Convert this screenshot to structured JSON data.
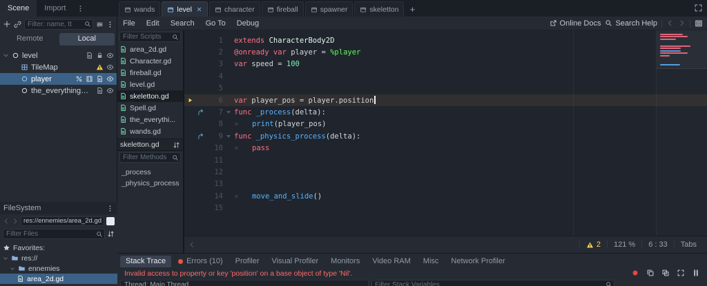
{
  "colors": {
    "accent": "#5d9de2",
    "selection": "#3c6186",
    "error": "#ff6b6b",
    "warning": "#ffd24d",
    "kw": "#ff7085",
    "fn": "#57b3ff",
    "type": "#e4f7ee",
    "id": "#d4d7dc",
    "uniq": "#63f95c",
    "num": "#7ef2b3",
    "script_icon": "#74dcb2",
    "exec_arrow": "#ffd24d",
    "override_arrow": "#62b2e2",
    "record": "#e8463c",
    "error_dot": "#f05540"
  },
  "top_bar": {
    "dock_tabs": [
      "Scene",
      "Import"
    ],
    "scene_tabs": [
      {
        "label": "wands",
        "active": false
      },
      {
        "label": "level",
        "active": true
      },
      {
        "label": "character",
        "active": false
      },
      {
        "label": "fireball",
        "active": false
      },
      {
        "label": "spawner",
        "active": false
      },
      {
        "label": "skeletton",
        "active": false
      }
    ],
    "add_tab_label": "+"
  },
  "menu": {
    "items": [
      "File",
      "Edit",
      "Search",
      "Go To",
      "Debug"
    ],
    "online_docs": "Online Docs",
    "search_help": "Search Help"
  },
  "scene_panel": {
    "filter_placeholder": "Filter: name, tt",
    "remote_label": "Remote",
    "local_label": "Local",
    "tree": [
      {
        "label": "level",
        "depth": 0,
        "arrow": true,
        "node_icon": "node",
        "node_color": "#dfe3e8",
        "right_icons": [
          "script",
          "lock",
          "eye"
        ],
        "selected": false
      },
      {
        "label": "TileMap",
        "depth": 1,
        "arrow": false,
        "node_icon": "tilemap",
        "node_color": "#8fb8e8",
        "right_icons": [
          "warning",
          "eye"
        ],
        "selected": false
      },
      {
        "label": "player",
        "depth": 1,
        "arrow": false,
        "node_icon": "node",
        "node_color": "#8fd0ff",
        "right_icons": [
          "percent",
          "film",
          "script",
          "eye"
        ],
        "selected": true
      },
      {
        "label": "the_everything_s...",
        "depth": 1,
        "arrow": false,
        "node_icon": "node",
        "node_color": "#dfe3e8",
        "right_icons": [
          "script",
          "eye"
        ],
        "selected": false
      }
    ]
  },
  "filesystem": {
    "title": "FileSystem",
    "breadcrumb": "res://ennemies/area_2d.gd",
    "filter_placeholder": "Filter Files",
    "tree": [
      {
        "label": "Favorites:",
        "icon": "star",
        "color": "#c9cfd7",
        "depth": 0,
        "arrow": false,
        "selected": false
      },
      {
        "label": "res://",
        "icon": "folder",
        "color": "#8fb0d8",
        "depth": 0,
        "arrow": true,
        "selected": false
      },
      {
        "label": "ennemies",
        "icon": "folder",
        "color": "#8fb0d8",
        "depth": 1,
        "arrow": true,
        "selected": false
      },
      {
        "label": "area_2d.gd",
        "icon": "script",
        "color": "#d8efe2",
        "depth": 2,
        "arrow": false,
        "selected": true
      }
    ]
  },
  "scripts_panel": {
    "filter_scripts": "Filter Scripts",
    "scripts": [
      {
        "name": "area_2d.gd",
        "selected": false
      },
      {
        "name": "Character.gd",
        "selected": false
      },
      {
        "name": "fireball.gd",
        "selected": false
      },
      {
        "name": "level.gd",
        "selected": false
      },
      {
        "name": "skeletton.gd",
        "selected": true
      },
      {
        "name": "Spell.gd",
        "selected": false
      },
      {
        "name": "the_everythi...",
        "selected": false
      },
      {
        "name": "wands.gd",
        "selected": false
      }
    ],
    "current": "skeletton.gd",
    "filter_methods": "Filter Methods",
    "methods": [
      "_process",
      "_physics_process"
    ]
  },
  "code": {
    "lines": [
      {
        "n": 1,
        "segs": [
          [
            "kw",
            "extends "
          ],
          [
            "type",
            "CharacterBody2D"
          ]
        ]
      },
      {
        "n": 2,
        "segs": [
          [
            "kw",
            "@onready "
          ],
          [
            "kw",
            "var "
          ],
          [
            "id",
            "player = "
          ],
          [
            "uniq",
            "%player"
          ]
        ]
      },
      {
        "n": 3,
        "segs": [
          [
            "kw",
            "var "
          ],
          [
            "id",
            "speed = "
          ],
          [
            "num",
            "100"
          ]
        ]
      },
      {
        "n": 4,
        "segs": []
      },
      {
        "n": 5,
        "segs": []
      },
      {
        "n": 6,
        "exec": true,
        "caret": true,
        "segs": [
          [
            "kw",
            "var "
          ],
          [
            "id",
            "player_pos = player.position"
          ]
        ]
      },
      {
        "n": 7,
        "g": "override",
        "fold": true,
        "segs": [
          [
            "kw",
            "func "
          ],
          [
            "fn",
            "_process"
          ],
          [
            "id",
            "(delta):"
          ]
        ]
      },
      {
        "n": 8,
        "tab": 1,
        "segs": [
          [
            "fn",
            "print"
          ],
          [
            "id",
            "(player_pos)"
          ]
        ]
      },
      {
        "n": 9,
        "g": "override",
        "fold": true,
        "segs": [
          [
            "kw",
            "func "
          ],
          [
            "fn",
            "_physics_process"
          ],
          [
            "id",
            "(delta):"
          ]
        ]
      },
      {
        "n": 10,
        "tab": 1,
        "segs": [
          [
            "kw",
            "pass"
          ]
        ]
      },
      {
        "n": 11,
        "segs": []
      },
      {
        "n": 12,
        "segs": []
      },
      {
        "n": 13,
        "segs": []
      },
      {
        "n": 14,
        "tab": 1,
        "segs": [
          [
            "fn",
            "move_and_slide"
          ],
          [
            "id",
            "()"
          ]
        ]
      },
      {
        "n": 15,
        "segs": []
      }
    ],
    "status": {
      "warnings": "2",
      "zoom": "121 %",
      "cursor": "6 : 33",
      "indent": "Tabs"
    }
  },
  "bottom_panel": {
    "tabs": [
      {
        "label": "Stack Trace",
        "active": true,
        "dot": false
      },
      {
        "label": "Errors (10)",
        "active": false,
        "dot": true
      },
      {
        "label": "Profiler",
        "active": false,
        "dot": false
      },
      {
        "label": "Visual Profiler",
        "active": false,
        "dot": false
      },
      {
        "label": "Monitors",
        "active": false,
        "dot": false
      },
      {
        "label": "Video RAM",
        "active": false,
        "dot": false
      },
      {
        "label": "Misc",
        "active": false,
        "dot": false
      },
      {
        "label": "Network Profiler",
        "active": false,
        "dot": false
      }
    ],
    "error": "Invalid access to property or key 'position' on a base object of type 'Nil'.",
    "thread": "Thread: Main Thread",
    "filter_stack": "Filter Stack Variables"
  }
}
